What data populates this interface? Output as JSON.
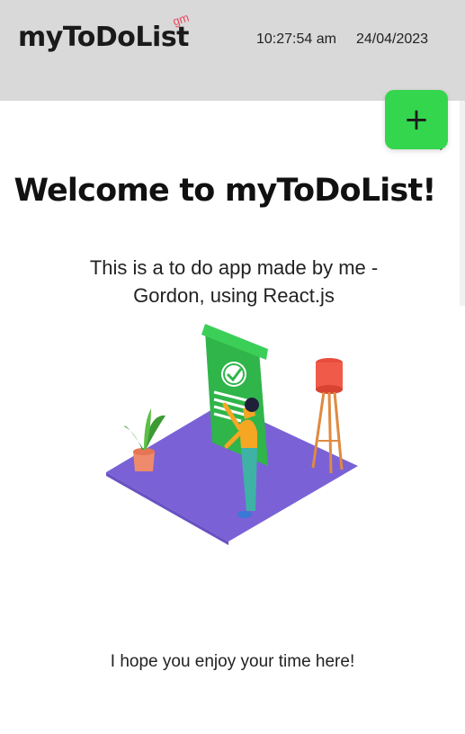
{
  "header": {
    "logo": "myToDoList",
    "logo_badge": "gm",
    "time": "10:27:54 am",
    "date": "24/04/2023"
  },
  "add_button": {
    "label": "+",
    "icon": "plus-icon",
    "color": "#34d64d"
  },
  "stray_text": ")",
  "main": {
    "title": "Welcome to myToDoList!",
    "intro": "This is a to do app made by me - Gordon, using React.js",
    "footer": "I hope you enjoy your time here!"
  },
  "illustration": {
    "icon": "todo-list-illustration"
  },
  "colors": {
    "header_bg": "#dad9d9",
    "accent": "#34d64d",
    "badge": "#e8475f",
    "floor": "#7a62d6"
  }
}
